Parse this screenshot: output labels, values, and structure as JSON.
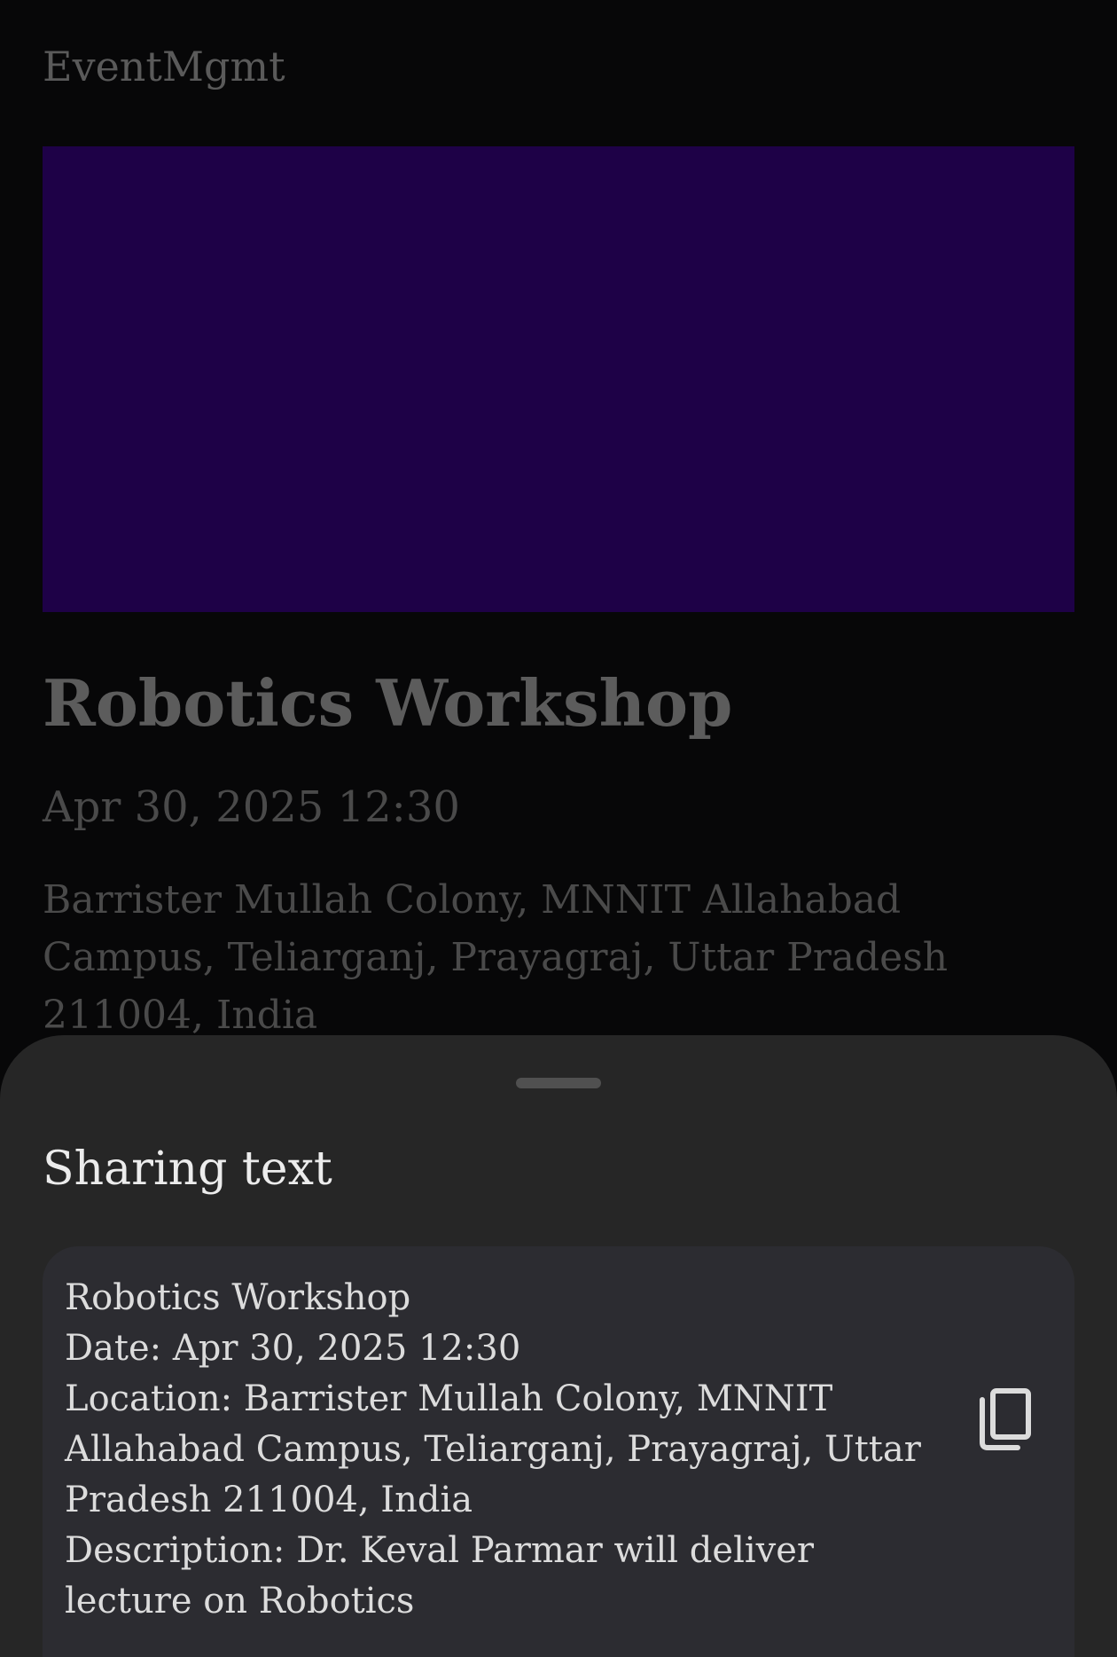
{
  "app": {
    "title": "EventMgmt"
  },
  "banner": {
    "color": "#1e0147"
  },
  "event": {
    "title": "Robotics Workshop",
    "datetime": "Apr 30, 2025 12:30",
    "location": "Barrister Mullah Colony, MNNIT Allahabad Campus, Teliarganj, Prayagraj, Uttar Pradesh 211004, India"
  },
  "sheet": {
    "title": "Sharing text",
    "lines": [
      "Robotics Workshop",
      "Date: Apr 30, 2025 12:30",
      "Location: Barrister Mullah Colony, MNNIT Allahabad Campus, Teliarganj, Prayagraj, Uttar Pradesh 211004, India",
      "Description: Dr. Keval Parmar will deliver lecture on Robotics"
    ],
    "copy_icon": "copy-icon"
  }
}
